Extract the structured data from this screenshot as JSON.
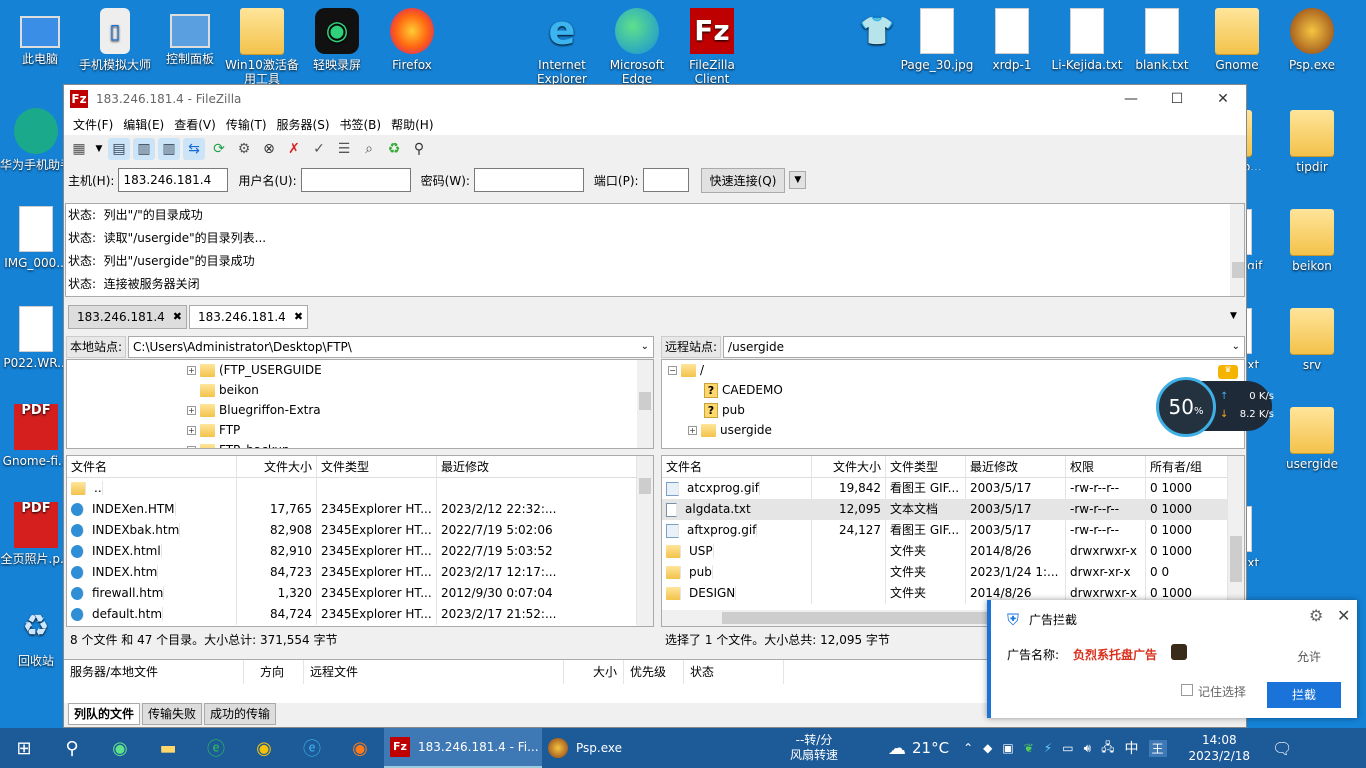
{
  "desktop": {
    "left_icons": [
      {
        "label": "此电脑",
        "icon": "computer-icon"
      },
      {
        "label": "手机模拟大师",
        "icon": "phone-emulator-icon"
      },
      {
        "label": "控制面板",
        "icon": "control-panel-icon"
      },
      {
        "label": "Win10激活备用工具",
        "icon": "folder-icon"
      },
      {
        "label": "轻映录屏",
        "icon": "screen-recorder-icon"
      },
      {
        "label": "Firefox",
        "icon": "firefox-icon"
      },
      {
        "label": "Internet Explorer",
        "icon": "ie-icon"
      },
      {
        "label": "Microsoft Edge",
        "icon": "edge-icon"
      },
      {
        "label": "FileZilla Client",
        "icon": "filezilla-icon"
      }
    ],
    "left_column": [
      {
        "label": "华为手机助手",
        "icon": "huawei-icon"
      },
      {
        "label": "IMG_000...",
        "icon": "image-file-icon"
      },
      {
        "label": "P022.WR...",
        "icon": "file-icon"
      },
      {
        "label": "Gnome-fi...",
        "icon": "pdf-icon"
      },
      {
        "label": "全页照片.p...",
        "icon": "pdf-icon"
      },
      {
        "label": "回收站",
        "icon": "recycle-bin-icon"
      }
    ],
    "right_icons": [
      {
        "label": "Page_30.jpg",
        "icon": "image-file-icon"
      },
      {
        "label": "xrdp-1",
        "icon": "file-icon"
      },
      {
        "label": "Li-Kejida.txt",
        "icon": "text-file-icon"
      },
      {
        "label": "blank.txt",
        "icon": "text-file-icon"
      },
      {
        "label": "Gnome",
        "icon": "folder-icon"
      },
      {
        "label": "Psp.exe",
        "icon": "psp-icon"
      }
    ],
    "right_column": [
      {
        "label": "tipdir",
        "icon": "folder-icon"
      },
      {
        "label": "beikon",
        "icon": "folder-icon"
      },
      {
        "label": "srv",
        "icon": "folder-icon"
      },
      {
        "label": "usergide",
        "icon": "folder-icon"
      }
    ],
    "partial_labels": [
      "co...",
      "g.gif",
      ".txt",
      ".txt"
    ]
  },
  "filezilla": {
    "title": "183.246.181.4 - FileZilla",
    "menu": [
      "文件(F)",
      "编辑(E)",
      "查看(V)",
      "传输(T)",
      "服务器(S)",
      "书签(B)",
      "帮助(H)"
    ],
    "quickconnect": {
      "host_label": "主机(H):",
      "host_value": "183.246.181.4",
      "user_label": "用户名(U):",
      "user_value": "",
      "pass_label": "密码(W):",
      "pass_value": "",
      "port_label": "端口(P):",
      "port_value": "",
      "button": "快速连接(Q)"
    },
    "log": [
      "状态:  列出\"/\"的目录成功",
      "状态:  读取\"/usergide\"的目录列表...",
      "状态:  列出\"/usergide\"的目录成功",
      "状态:  连接被服务器关闭"
    ],
    "tabs": [
      "183.246.181.4",
      "183.246.181.4"
    ],
    "local": {
      "site_label": "本地站点:",
      "path": "C:\\Users\\Administrator\\Desktop\\FTP\\",
      "tree": [
        "(FTP_USERGUIDE",
        "beikon",
        "Bluegriffon-Extra",
        "FTP",
        "FTP_backup"
      ],
      "columns": [
        "文件名",
        "文件大小",
        "文件类型",
        "最近修改"
      ],
      "files": [
        {
          "name": "..",
          "size": "",
          "type": "",
          "modified": ""
        },
        {
          "name": "INDEXen.HTM",
          "size": "17,765",
          "type": "2345Explorer HT...",
          "modified": "2023/2/12 22:32:..."
        },
        {
          "name": "INDEXbak.htm",
          "size": "82,908",
          "type": "2345Explorer HT...",
          "modified": "2022/7/19 5:02:06"
        },
        {
          "name": "INDEX.html",
          "size": "82,910",
          "type": "2345Explorer HT...",
          "modified": "2022/7/19 5:03:52"
        },
        {
          "name": "INDEX.htm",
          "size": "84,723",
          "type": "2345Explorer HT...",
          "modified": "2023/2/17 12:17:..."
        },
        {
          "name": "firewall.htm",
          "size": "1,320",
          "type": "2345Explorer HT...",
          "modified": "2012/9/30 0:07:04"
        },
        {
          "name": "default.htm",
          "size": "84,724",
          "type": "2345Explorer HT...",
          "modified": "2023/2/17 21:52:..."
        }
      ],
      "status": "8 个文件 和 47 个目录。大小总计: 371,554 字节"
    },
    "remote": {
      "site_label": "远程站点:",
      "path": "/usergide",
      "tree_root": "/",
      "tree": [
        "CAEDEMO",
        "pub",
        "usergide"
      ],
      "columns": [
        "文件名",
        "文件大小",
        "文件类型",
        "最近修改",
        "权限",
        "所有者/组"
      ],
      "files": [
        {
          "name": "atcxprog.gif",
          "size": "19,842",
          "type": "看图王 GIF...",
          "modified": "2003/5/17",
          "perm": "-rw-r--r--",
          "owner": "0 1000",
          "kind": "gif"
        },
        {
          "name": "algdata.txt",
          "size": "12,095",
          "type": "文本文档",
          "modified": "2003/5/17",
          "perm": "-rw-r--r--",
          "owner": "0 1000",
          "kind": "txt"
        },
        {
          "name": "aftxprog.gif",
          "size": "24,127",
          "type": "看图王 GIF...",
          "modified": "2003/5/17",
          "perm": "-rw-r--r--",
          "owner": "0 1000",
          "kind": "gif"
        },
        {
          "name": "USP",
          "size": "",
          "type": "文件夹",
          "modified": "2014/8/26",
          "perm": "drwxrwxr-x",
          "owner": "0 1000",
          "kind": "folder"
        },
        {
          "name": "pub",
          "size": "",
          "type": "文件夹",
          "modified": "2023/1/24 1:...",
          "perm": "drwxr-xr-x",
          "owner": "0 0",
          "kind": "folder"
        },
        {
          "name": "DESIGN",
          "size": "",
          "type": "文件夹",
          "modified": "2014/8/26",
          "perm": "drwxrwxr-x",
          "owner": "0 1000",
          "kind": "folder"
        }
      ],
      "status": "选择了 1 个文件。大小总共: 12,095 字节"
    },
    "queue_columns": [
      "服务器/本地文件",
      "方向",
      "远程文件",
      "大小",
      "优先级",
      "状态"
    ],
    "queue_tabs": [
      "列队的文件",
      "传输失败",
      "成功的传输"
    ]
  },
  "speed_widget": {
    "percent": "50",
    "percent_unit": "%",
    "up": "0",
    "down": "8.2",
    "unit": "K/s"
  },
  "ad_popup": {
    "title": "广告拦截",
    "name_label": "广告名称:",
    "name_value": "负烈系托盘广告",
    "allow": "允许",
    "remember": "记住选择",
    "block": "拦截"
  },
  "taskbar": {
    "filezilla": "183.246.181.4 - Fi...",
    "psp": "Psp.exe",
    "fan_speed": "--转/分",
    "fan_label": "风扇转速",
    "weather": "21°C",
    "ime": "中",
    "time": "14:08",
    "date": "2023/2/18"
  }
}
